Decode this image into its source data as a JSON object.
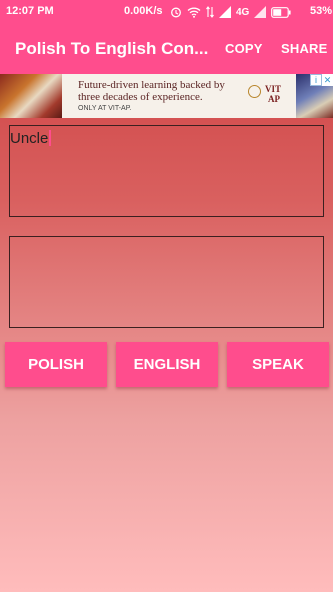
{
  "status_bar": {
    "time": "12:07 PM",
    "speed": "0.00K/s",
    "network": "4G",
    "battery": "53%",
    "icons": [
      "alarm-icon",
      "wifi-icon",
      "signal-icon",
      "signal-icon",
      "battery-icon"
    ]
  },
  "app_bar": {
    "title": "Polish To English Con...",
    "copy_label": "COPY",
    "share_label": "SHARE"
  },
  "ad_banner": {
    "line1": "Future-driven learning backed by",
    "line2": "three decades of experience.",
    "line3": "ONLY AT VIT-AP.",
    "logo_top": "VIT",
    "logo_bottom": "AP"
  },
  "input_box": {
    "value": "Uncle"
  },
  "output_box": {
    "value": ""
  },
  "buttons": {
    "polish": "POLISH",
    "english": "ENGLISH",
    "speak": "SPEAK"
  },
  "colors": {
    "accent": "#ff4d8d",
    "background_top": "#cc3d3f",
    "background_bottom": "#ffbcbc"
  }
}
